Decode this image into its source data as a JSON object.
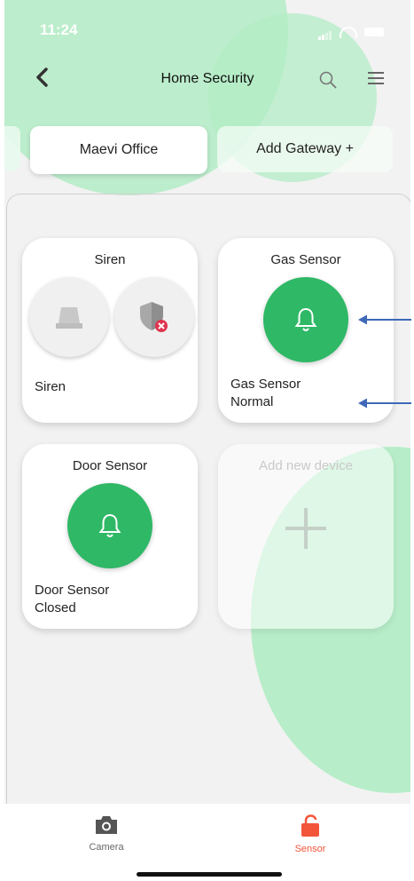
{
  "status_bar": {
    "time": "11:24"
  },
  "header": {
    "title": "Home Security"
  },
  "gateway_tabs": {
    "active": "Maevi Office",
    "add": "Add Gateway +"
  },
  "devices": {
    "siren": {
      "title": "Siren",
      "info_line1": "Siren"
    },
    "gas": {
      "title": "Gas Sensor",
      "info_line1": "Gas Sensor",
      "info_line2": "Normal"
    },
    "door": {
      "title": "Door Sensor",
      "info_line1": "Door Sensor",
      "info_line2": "Closed"
    },
    "add": {
      "title": "Add new device"
    }
  },
  "tabbar": {
    "camera": {
      "label": "Camera"
    },
    "sensor": {
      "label": "Sensor"
    }
  },
  "colors": {
    "accent_green": "#2fb866",
    "active_tab": "#f2553a",
    "arrow": "#3f68b8"
  }
}
